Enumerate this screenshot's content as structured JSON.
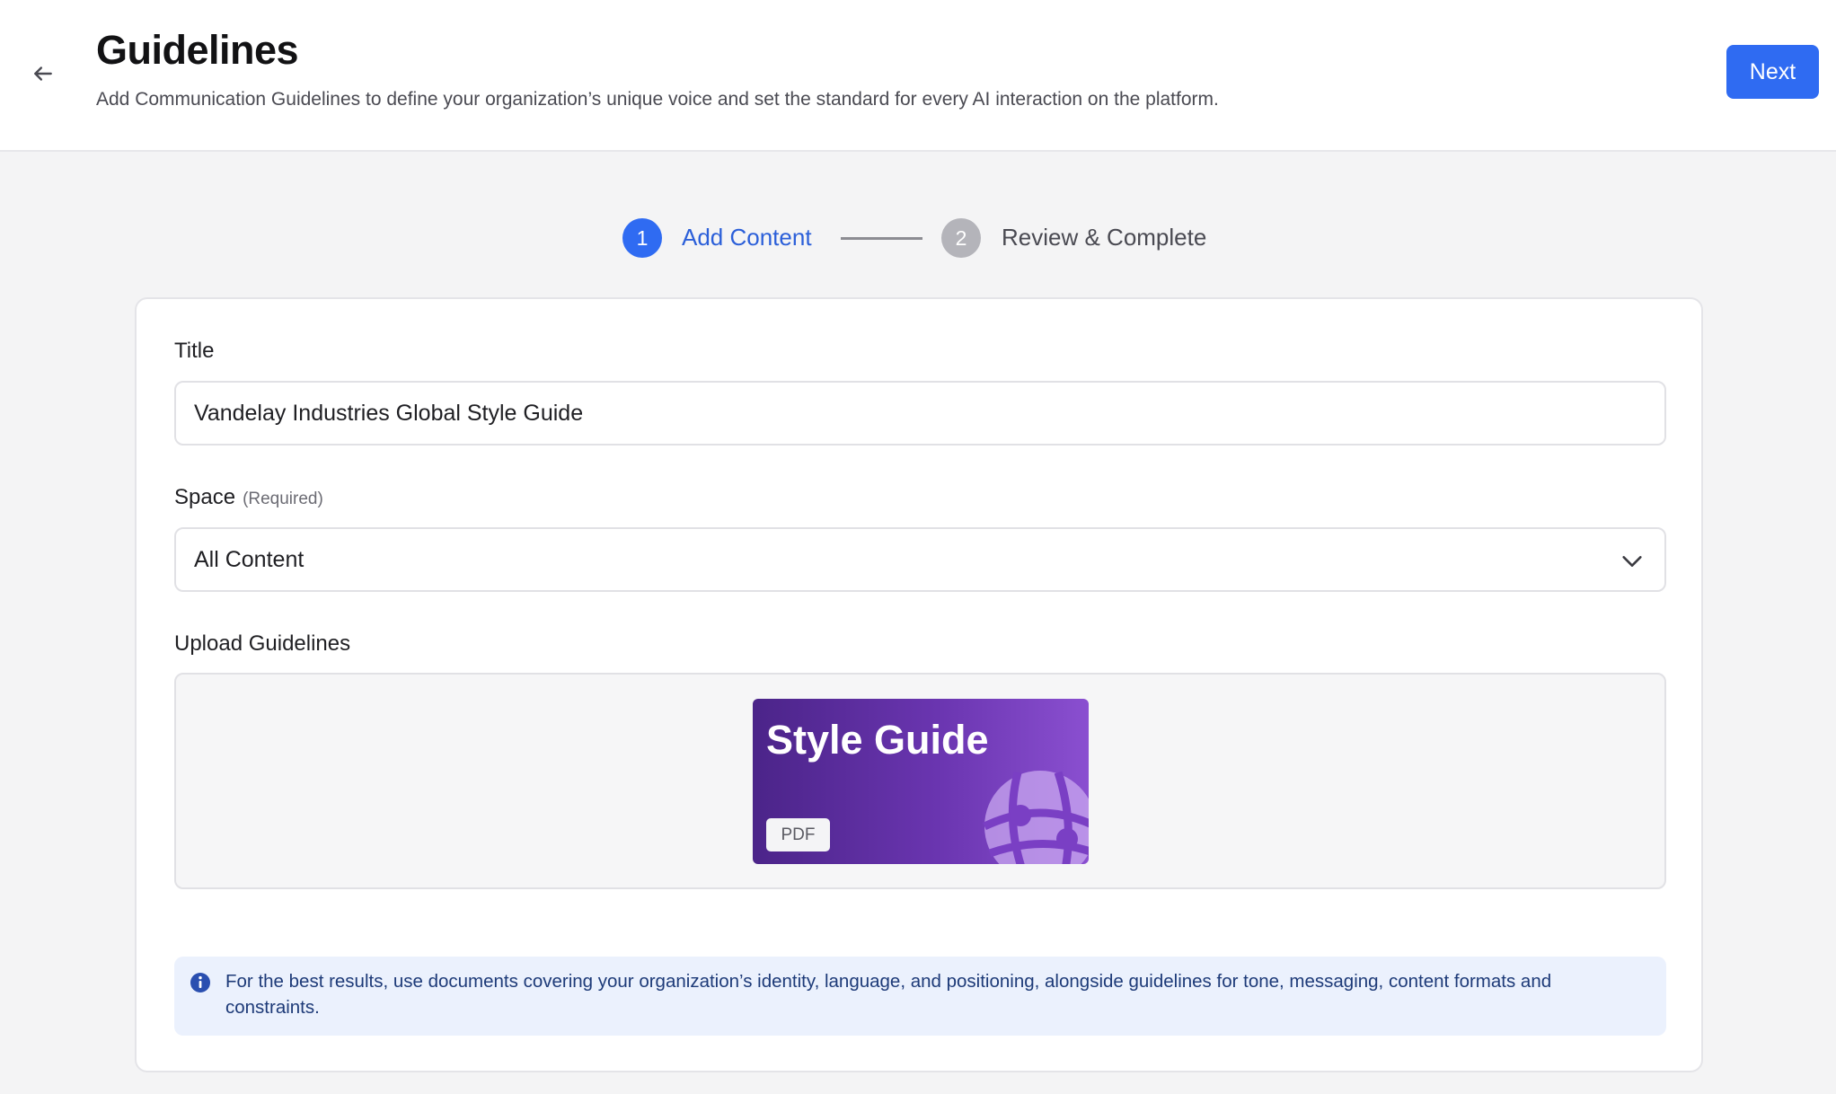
{
  "header": {
    "back_icon": "arrow-left-icon",
    "title": "Guidelines",
    "subtitle": "Add Communication Guidelines to define your organization’s unique voice and set the standard for every AI interaction on the platform.",
    "next_label": "Next"
  },
  "stepper": {
    "steps": [
      {
        "number": "1",
        "label": "Add Content",
        "state": "active"
      },
      {
        "number": "2",
        "label": "Review & Complete",
        "state": "inactive"
      }
    ]
  },
  "form": {
    "title_label": "Title",
    "title_value": "Vandelay Industries Global Style Guide",
    "space_label": "Space",
    "space_required": "(Required)",
    "space_value": "All Content",
    "space_icon": "chevron-down-icon",
    "upload_label": "Upload Guidelines",
    "upload_file": {
      "thumbnail_title": "Style Guide",
      "file_type": "PDF",
      "icon": "globe-icon"
    },
    "info_icon": "info-icon",
    "info_text": "For the best results, use documents covering your organization’s identity, language, and positioning, alongside guidelines for tone, messaging, content formats and constraints."
  },
  "colors": {
    "accent": "#2f6bf2",
    "info_background": "#ebf1fd",
    "info_text": "#1d3a78",
    "thumbnail_gradient_start": "#4b2489",
    "thumbnail_gradient_end": "#8a4fd0",
    "inactive_step": "#b4b4ba"
  }
}
